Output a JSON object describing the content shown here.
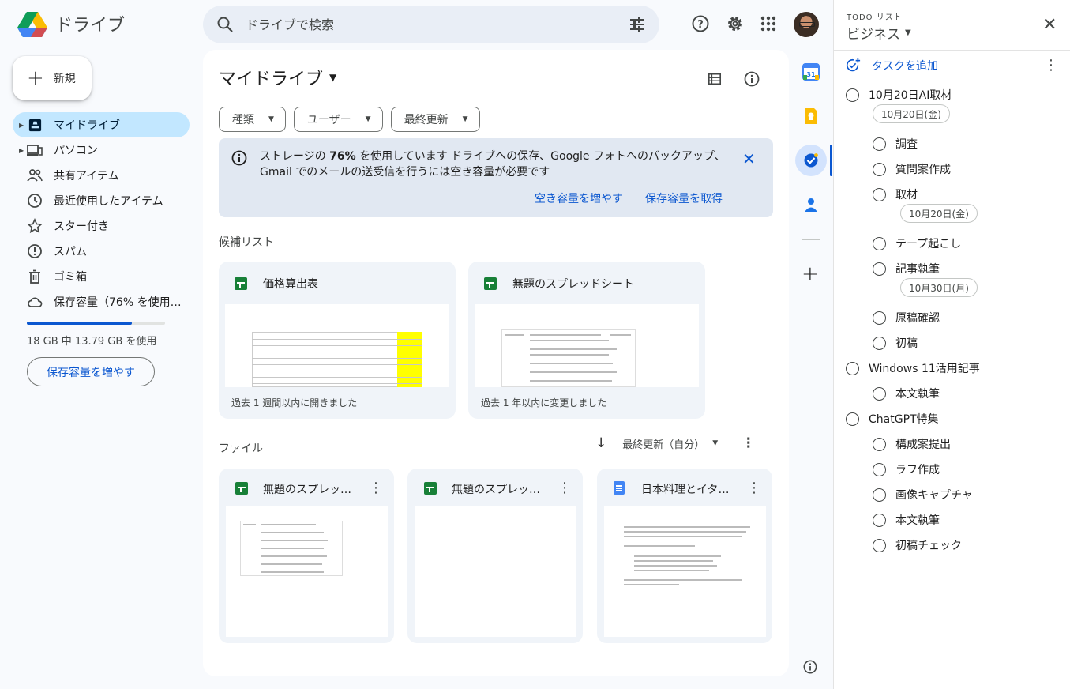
{
  "app": {
    "name": "ドライブ",
    "search_placeholder": "ドライブで検索"
  },
  "sidebar": {
    "new_label": "新規",
    "items": [
      {
        "label": "マイドライブ",
        "icon": "my-drive-icon",
        "active": true
      },
      {
        "label": "パソコン",
        "icon": "computer-icon"
      },
      {
        "label": "共有アイテム",
        "icon": "shared-icon"
      },
      {
        "label": "最近使用したアイテム",
        "icon": "clock-icon"
      },
      {
        "label": "スター付き",
        "icon": "star-icon"
      },
      {
        "label": "スパム",
        "icon": "spam-icon"
      },
      {
        "label": "ゴミ箱",
        "icon": "trash-icon"
      },
      {
        "label": "保存容量（76% を使用中...",
        "icon": "cloud-icon"
      }
    ],
    "storage_fraction": 0.76,
    "storage_text": "18 GB 中 13.79 GB を使用",
    "storage_button": "保存容量を増やす"
  },
  "main": {
    "title": "マイドライブ",
    "filters": [
      "種類",
      "ユーザー",
      "最終更新"
    ],
    "banner": {
      "text_before": "ストレージの ",
      "text_bold": "76%",
      "text_after": " を使用しています ドライブへの保存、Google フォトへのバックアップ、Gmail でのメールの送受信を行うには空き容量が必要です",
      "link1": "空き容量を増やす",
      "link2": "保存容量を取得"
    },
    "suggested_label": "候補リスト",
    "suggested": [
      {
        "title": "価格算出表",
        "subtitle": "過去 1 週間以内に開きました"
      },
      {
        "title": "無題のスプレッドシート",
        "subtitle": "過去 1 年以内に変更しました"
      }
    ],
    "files_label": "ファイル",
    "sort_label": "最終更新（自分）",
    "files": [
      {
        "title": "無題のスプレッドシート",
        "type": "sheet"
      },
      {
        "title": "無題のスプレッドシート",
        "type": "sheet"
      },
      {
        "title": "日本料理とイタリア料理",
        "type": "doc"
      }
    ]
  },
  "tasks": {
    "header_sub": "TODO リスト",
    "list_name": "ビジネス",
    "add_label": "タスクを追加",
    "items": [
      {
        "title": "10月20日AI取材",
        "date": "10月20日(金)"
      },
      {
        "title": "調査",
        "sub": true
      },
      {
        "title": "質問案作成",
        "sub": true
      },
      {
        "title": "取材",
        "sub": true,
        "date": "10月20日(金)"
      },
      {
        "title": "テープ起こし",
        "sub": true
      },
      {
        "title": "記事執筆",
        "sub": true,
        "date": "10月30日(月)"
      },
      {
        "title": "原稿確認",
        "sub": true
      },
      {
        "title": "初稿",
        "sub": true
      },
      {
        "title": "Windows 11活用記事"
      },
      {
        "title": "本文執筆",
        "sub": true
      },
      {
        "title": "ChatGPT特集"
      },
      {
        "title": "構成案提出",
        "sub": true
      },
      {
        "title": "ラフ作成",
        "sub": true
      },
      {
        "title": "画像キャプチャ",
        "sub": true
      },
      {
        "title": "本文執筆",
        "sub": true
      },
      {
        "title": "初稿チェック",
        "sub": true
      }
    ]
  },
  "colors": {
    "accent": "#0b57d0",
    "active_nav": "#c2e7ff",
    "sheet_green": "#188038",
    "doc_blue": "#4285f4",
    "highlight_yellow": "#ffff00"
  }
}
